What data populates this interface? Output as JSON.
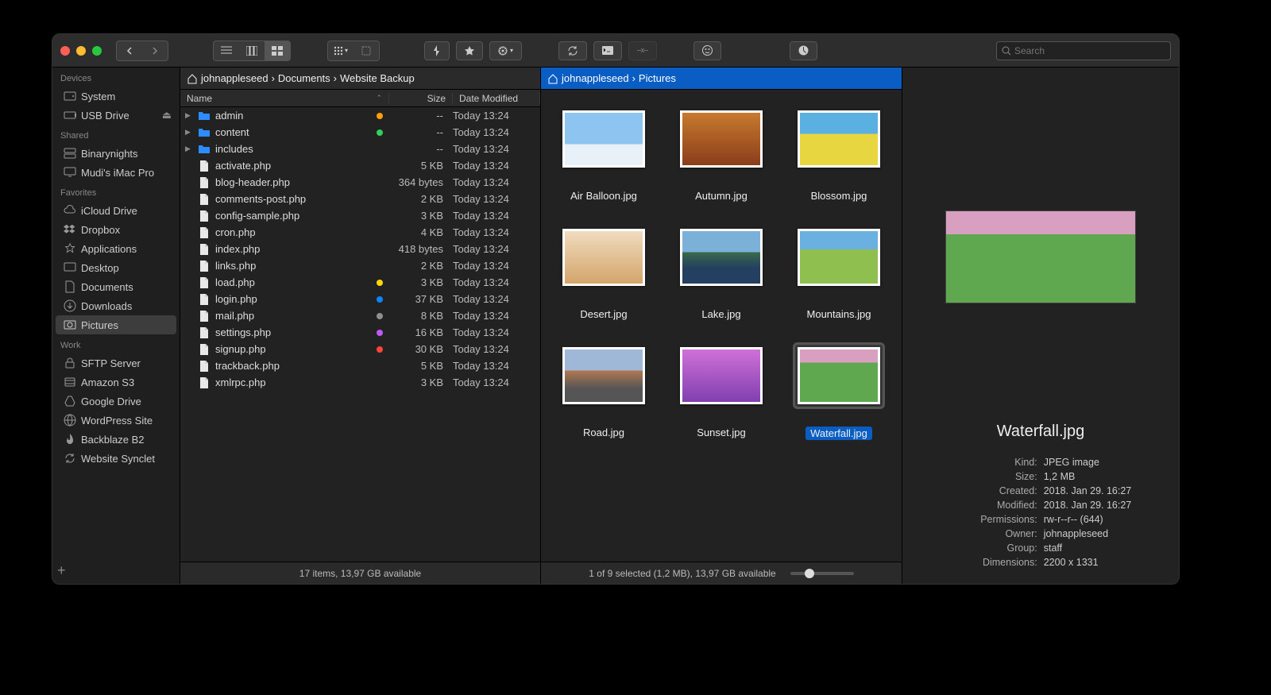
{
  "search_placeholder": "Search",
  "sidebar": {
    "groups": [
      {
        "label": "Devices",
        "items": [
          {
            "icon": "drive-icon",
            "label": "System"
          },
          {
            "icon": "usb-icon",
            "label": "USB Drive",
            "eject": true
          }
        ]
      },
      {
        "label": "Shared",
        "items": [
          {
            "icon": "server-icon",
            "label": "Binarynights"
          },
          {
            "icon": "imac-icon",
            "label": "Mudi's iMac Pro"
          }
        ]
      },
      {
        "label": "Favorites",
        "items": [
          {
            "icon": "cloud-icon",
            "label": "iCloud Drive"
          },
          {
            "icon": "dropbox-icon",
            "label": "Dropbox"
          },
          {
            "icon": "apps-icon",
            "label": "Applications"
          },
          {
            "icon": "desktop-icon",
            "label": "Desktop"
          },
          {
            "icon": "doc-icon",
            "label": "Documents"
          },
          {
            "icon": "download-icon",
            "label": "Downloads"
          },
          {
            "icon": "pictures-icon",
            "label": "Pictures",
            "selected": true
          }
        ]
      },
      {
        "label": "Work",
        "items": [
          {
            "icon": "lock-icon",
            "label": "SFTP Server"
          },
          {
            "icon": "s3-icon",
            "label": "Amazon S3"
          },
          {
            "icon": "gdrive-icon",
            "label": "Google Drive"
          },
          {
            "icon": "globe-icon",
            "label": "WordPress Site"
          },
          {
            "icon": "backblaze-icon",
            "label": "Backblaze B2"
          },
          {
            "icon": "sync-icon",
            "label": "Website Synclet"
          }
        ]
      }
    ]
  },
  "left": {
    "crumbs": [
      "johnappleseed",
      "Documents",
      "Website Backup"
    ],
    "columns": {
      "name": "Name",
      "size": "Size",
      "date": "Date Modified"
    },
    "files": [
      {
        "kind": "folder",
        "name": "admin",
        "tag": "#ff9f0a",
        "size": "--",
        "date": "Today 13:24"
      },
      {
        "kind": "folder",
        "name": "content",
        "tag": "#30d158",
        "size": "--",
        "date": "Today 13:24"
      },
      {
        "kind": "folder",
        "name": "includes",
        "tag": null,
        "size": "--",
        "date": "Today 13:24"
      },
      {
        "kind": "file",
        "name": "activate.php",
        "tag": null,
        "size": "5 KB",
        "date": "Today 13:24"
      },
      {
        "kind": "file",
        "name": "blog-header.php",
        "tag": null,
        "size": "364 bytes",
        "date": "Today 13:24"
      },
      {
        "kind": "file",
        "name": "comments-post.php",
        "tag": null,
        "size": "2 KB",
        "date": "Today 13:24"
      },
      {
        "kind": "file",
        "name": "config-sample.php",
        "tag": null,
        "size": "3 KB",
        "date": "Today 13:24"
      },
      {
        "kind": "file",
        "name": "cron.php",
        "tag": null,
        "size": "4 KB",
        "date": "Today 13:24"
      },
      {
        "kind": "file",
        "name": "index.php",
        "tag": null,
        "size": "418 bytes",
        "date": "Today 13:24"
      },
      {
        "kind": "file",
        "name": "links.php",
        "tag": null,
        "size": "2 KB",
        "date": "Today 13:24"
      },
      {
        "kind": "file",
        "name": "load.php",
        "tag": "#ffd60a",
        "size": "3 KB",
        "date": "Today 13:24"
      },
      {
        "kind": "file",
        "name": "login.php",
        "tag": "#0a84ff",
        "size": "37 KB",
        "date": "Today 13:24"
      },
      {
        "kind": "file",
        "name": "mail.php",
        "tag": "#8e8e93",
        "size": "8 KB",
        "date": "Today 13:24"
      },
      {
        "kind": "file",
        "name": "settings.php",
        "tag": "#bf5af2",
        "size": "16 KB",
        "date": "Today 13:24"
      },
      {
        "kind": "file",
        "name": "signup.php",
        "tag": "#ff453a",
        "size": "30 KB",
        "date": "Today 13:24"
      },
      {
        "kind": "file",
        "name": "trackback.php",
        "tag": null,
        "size": "5 KB",
        "date": "Today 13:24"
      },
      {
        "kind": "file",
        "name": "xmlrpc.php",
        "tag": null,
        "size": "3 KB",
        "date": "Today 13:24"
      }
    ],
    "status": "17 items, 13,97 GB available"
  },
  "right": {
    "crumbs": [
      "johnappleseed",
      "Pictures"
    ],
    "items": [
      {
        "name": "Air Balloon.jpg",
        "cls": "t-balloon"
      },
      {
        "name": "Autumn.jpg",
        "cls": "t-autumn"
      },
      {
        "name": "Blossom.jpg",
        "cls": "t-blossom"
      },
      {
        "name": "Desert.jpg",
        "cls": "t-desert"
      },
      {
        "name": "Lake.jpg",
        "cls": "t-lake"
      },
      {
        "name": "Mountains.jpg",
        "cls": "t-mountains"
      },
      {
        "name": "Road.jpg",
        "cls": "t-road"
      },
      {
        "name": "Sunset.jpg",
        "cls": "t-sunset"
      },
      {
        "name": "Waterfall.jpg",
        "cls": "t-waterfall",
        "selected": true
      }
    ],
    "status": "1 of 9 selected (1,2 MB), 13,97 GB available"
  },
  "inspector": {
    "title": "Waterfall.jpg",
    "rows": [
      {
        "k": "Kind:",
        "v": "JPEG image"
      },
      {
        "k": "Size:",
        "v": "1,2 MB"
      },
      {
        "k": "Created:",
        "v": "2018. Jan 29. 16:27"
      },
      {
        "k": "Modified:",
        "v": "2018. Jan 29. 16:27"
      },
      {
        "k": "Permissions:",
        "v": "rw-r--r-- (644)"
      },
      {
        "k": "Owner:",
        "v": "johnappleseed"
      },
      {
        "k": "Group:",
        "v": "staff"
      },
      {
        "k": "Dimensions:",
        "v": "2200 x 1331"
      }
    ]
  }
}
